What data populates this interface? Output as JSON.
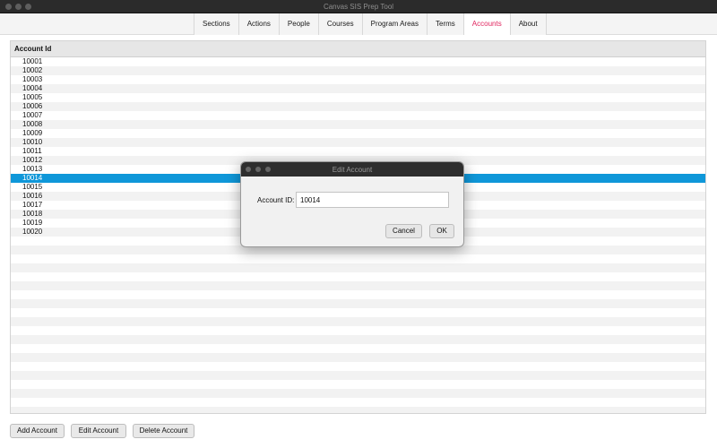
{
  "window": {
    "title": "Canvas SIS Prep Tool"
  },
  "tabs": [
    {
      "label": "Sections"
    },
    {
      "label": "Actions"
    },
    {
      "label": "People"
    },
    {
      "label": "Courses"
    },
    {
      "label": "Program Areas"
    },
    {
      "label": "Terms"
    },
    {
      "label": "Accounts",
      "active": true
    },
    {
      "label": "About"
    }
  ],
  "table": {
    "header": "Account Id",
    "rows": [
      "10001",
      "10002",
      "10003",
      "10004",
      "10005",
      "10006",
      "10007",
      "10008",
      "10009",
      "10010",
      "10011",
      "10012",
      "10013",
      "10014",
      "10015",
      "10016",
      "10017",
      "10018",
      "10019",
      "10020"
    ],
    "selected": "10014"
  },
  "buttons": {
    "add": "Add Account",
    "edit": "Edit Account",
    "delete": "Delete Account"
  },
  "dialog": {
    "title": "Edit Account",
    "field_label": "Account ID:",
    "field_value": "10014",
    "cancel": "Cancel",
    "ok": "OK"
  },
  "colors": {
    "active_tab": "#e0245e",
    "selection": "#0f97d9"
  }
}
